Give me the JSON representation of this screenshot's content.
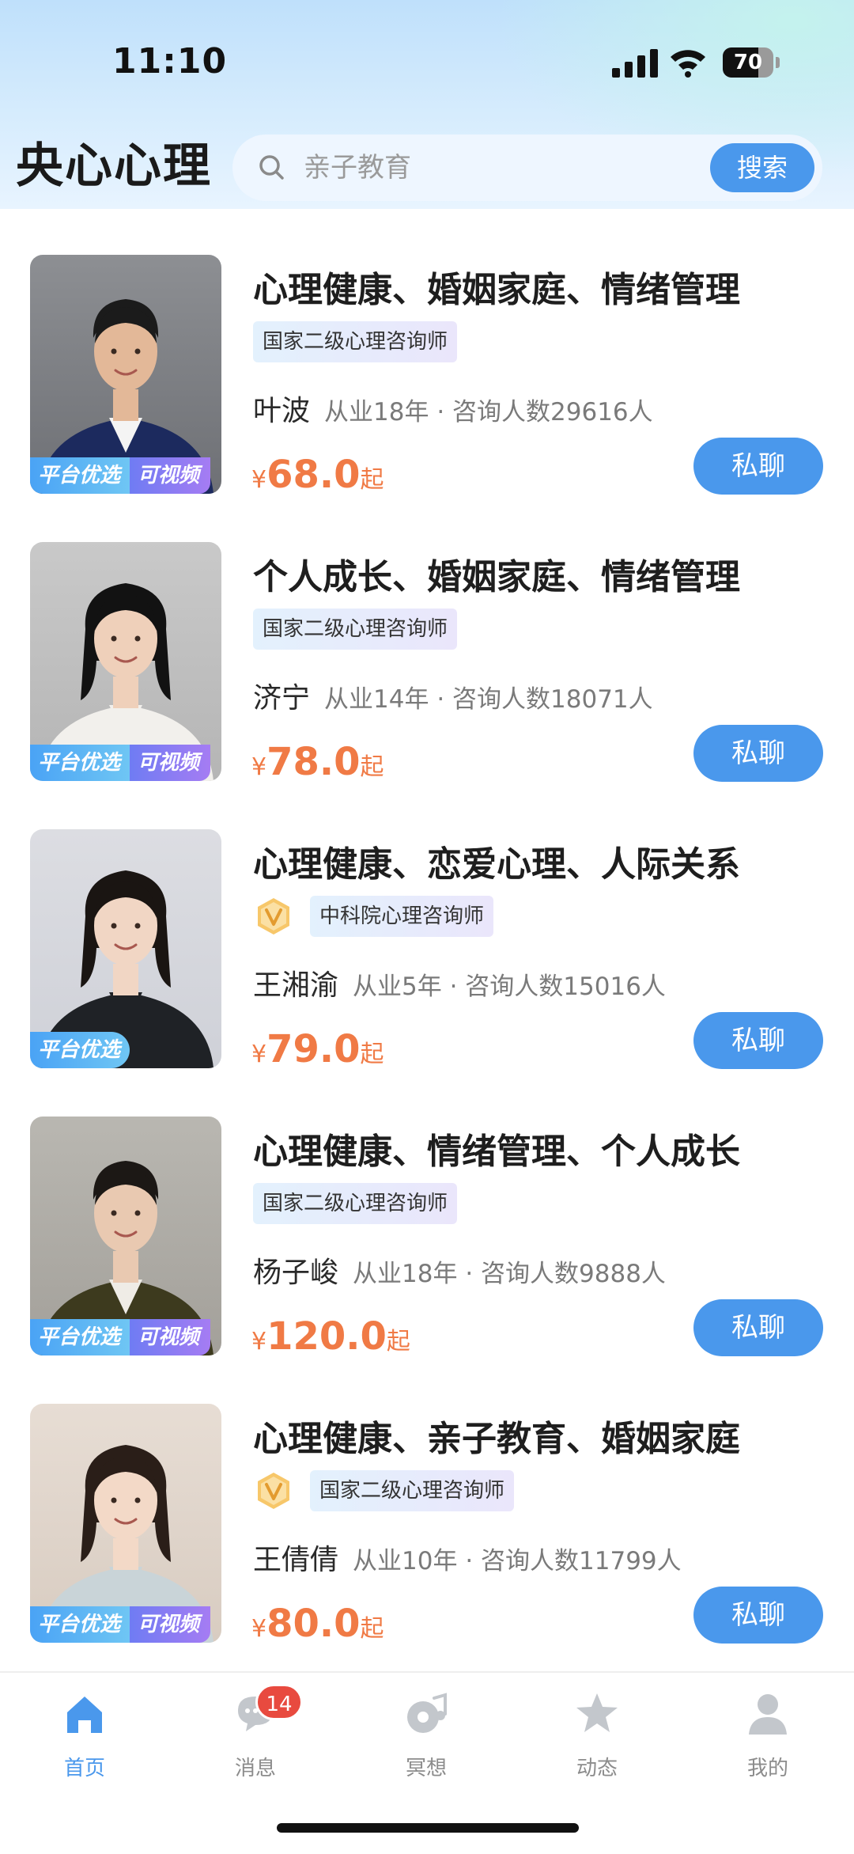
{
  "status_bar": {
    "time": "11:10",
    "battery": "70",
    "battery_level": 0.7
  },
  "header": {
    "app_title": "央心心理",
    "search": {
      "placeholder": "亲子教育",
      "button_label": "搜索"
    }
  },
  "consultants": [
    {
      "title": "心理健康、婚姻家庭、情绪管理",
      "certificate": "国家二级心理咨询师",
      "verified": false,
      "name": "叶波",
      "meta": "从业18年 · 咨询人数29616人",
      "price_symbol": "¥",
      "price": "68.0",
      "price_suffix": "起",
      "badges": [
        "平台优选",
        "可视频"
      ],
      "chat_label": "私聊"
    },
    {
      "title": "个人成长、婚姻家庭、情绪管理",
      "certificate": "国家二级心理咨询师",
      "verified": false,
      "name": "济宁",
      "meta": "从业14年 · 咨询人数18071人",
      "price_symbol": "¥",
      "price": "78.0",
      "price_suffix": "起",
      "badges": [
        "平台优选",
        "可视频"
      ],
      "chat_label": "私聊"
    },
    {
      "title": "心理健康、恋爱心理、人际关系",
      "certificate": "中科院心理咨询师",
      "verified": true,
      "name": "王湘渝",
      "meta": "从业5年 · 咨询人数15016人",
      "price_symbol": "¥",
      "price": "79.0",
      "price_suffix": "起",
      "badges": [
        "平台优选"
      ],
      "chat_label": "私聊"
    },
    {
      "title": "心理健康、情绪管理、个人成长",
      "certificate": "国家二级心理咨询师",
      "verified": false,
      "name": "杨子峻",
      "meta": "从业18年 · 咨询人数9888人",
      "price_symbol": "¥",
      "price": "120.0",
      "price_suffix": "起",
      "badges": [
        "平台优选",
        "可视频"
      ],
      "chat_label": "私聊"
    },
    {
      "title": "心理健康、亲子教育、婚姻家庭",
      "certificate": "国家二级心理咨询师",
      "verified": true,
      "name": "王倩倩",
      "meta": "从业10年 · 咨询人数11799人",
      "price_symbol": "¥",
      "price": "80.0",
      "price_suffix": "起",
      "badges": [
        "平台优选",
        "可视频"
      ],
      "chat_label": "私聊"
    }
  ],
  "tabbar": {
    "items": [
      {
        "label": "首页",
        "icon": "home-icon",
        "active": true
      },
      {
        "label": "消息",
        "icon": "message-icon",
        "badge": "14"
      },
      {
        "label": "冥想",
        "icon": "meditation-icon"
      },
      {
        "label": "动态",
        "icon": "star-icon"
      },
      {
        "label": "我的",
        "icon": "profile-icon"
      }
    ]
  },
  "colors": {
    "accent": "#4a98ec",
    "price": "#f07a45",
    "badge_red": "#e84a3f",
    "header_top": "#bfe0fb"
  }
}
